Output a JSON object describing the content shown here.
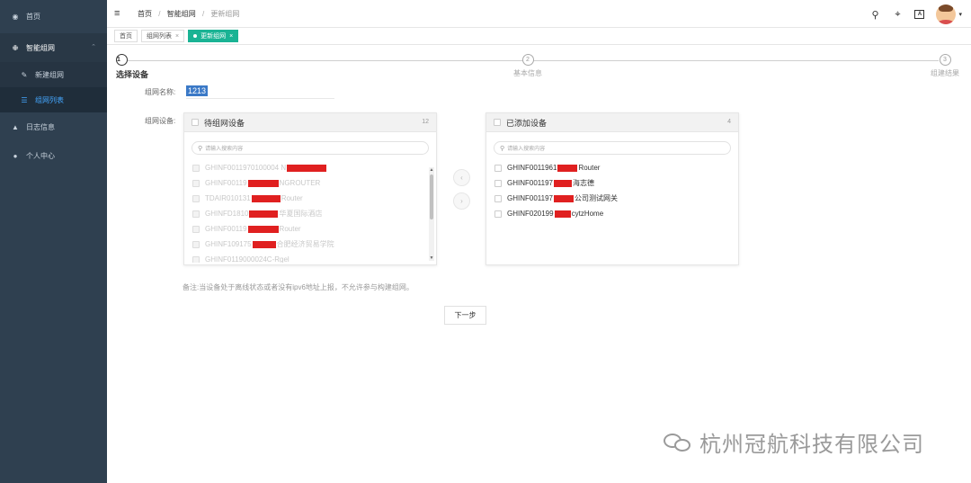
{
  "sidebar": {
    "home": "首页",
    "smart_network": "智能组网",
    "sub_new": "新建组网",
    "sub_list": "组网列表",
    "log_info": "日志信息",
    "personal": "个人中心"
  },
  "header": {
    "breadcrumb": [
      "首页",
      "智能组网",
      "更新组网"
    ]
  },
  "tabs": [
    {
      "label": "首页"
    },
    {
      "label": "组网列表"
    },
    {
      "label": "更新组网"
    }
  ],
  "steps": [
    {
      "num": "1",
      "label": "选择设备"
    },
    {
      "num": "2",
      "label": "基本信息"
    },
    {
      "num": "3",
      "label": "组建结果"
    }
  ],
  "form": {
    "name_label": "组网名称:",
    "name_value": "1213",
    "devices_label": "组网设备:"
  },
  "left_panel": {
    "title": "待组网设备",
    "count": "12",
    "search_placeholder": "请输入搜索内容",
    "items": [
      {
        "a": "GHINF0011970100004 N",
        "b": ""
      },
      {
        "a": "GHINF00119",
        "b": "NGROUTER"
      },
      {
        "a": "TDAIR010131",
        "b": "Router"
      },
      {
        "a": "GHINFD1810",
        "b": "华夏国际酒店"
      },
      {
        "a": "GHINF00119",
        "b": "Router"
      },
      {
        "a": "GHINF109175",
        "b": "合肥经济贸易学院"
      },
      {
        "a": "GHINF0119000024C",
        "b": "-Rgel"
      }
    ]
  },
  "right_panel": {
    "title": "已添加设备",
    "count": "4",
    "search_placeholder": "请输入搜索内容",
    "items": [
      {
        "a": "GHINF0011961",
        "b": "Router"
      },
      {
        "a": "GHINF001197",
        "b": "海志德"
      },
      {
        "a": "GHINF001197",
        "b": "公司测试网关"
      },
      {
        "a": "GHINF020199",
        "b": "cytzHome"
      }
    ]
  },
  "note": "备注:当设备处于离线状态或者没有ipv6地址上报，不允许参与构建组网。",
  "next_button": "下一步",
  "watermark": "杭州冠航科技有限公司"
}
